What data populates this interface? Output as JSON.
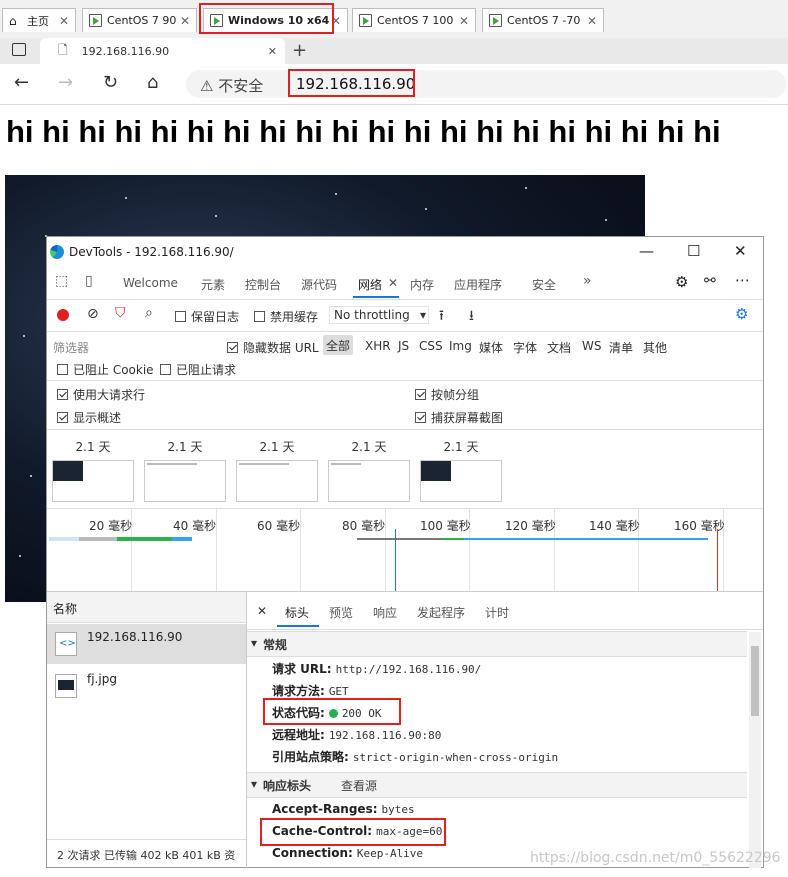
{
  "vm_tabs": [
    {
      "label": "主页"
    },
    {
      "label": "CentOS 7 90"
    },
    {
      "label": "Windows 10 x64",
      "active": true
    },
    {
      "label": "CentOS 7 100"
    },
    {
      "label": "CentOS 7 -70"
    }
  ],
  "browser": {
    "tab_title": "192.168.116.90",
    "insecure_label": "不安全",
    "url": "192.168.116.90"
  },
  "page": {
    "hi_text": "hi hi hi hi hi hi hi hi hi hi hi hi hi hi hi hi hi hi hi hi"
  },
  "devtools": {
    "title": "DevTools - 192.168.116.90/",
    "tabs": [
      "Welcome",
      "元素",
      "控制台",
      "源代码",
      "网络",
      "内存",
      "应用程序",
      "安全"
    ],
    "selected_tab": "网络",
    "toolbar": {
      "preserve_log": "保留日志",
      "disable_cache": "禁用缓存",
      "throttling": "No throttling"
    },
    "filter": {
      "placeholder": "筛选器",
      "hide_data_url": "隐藏数据 URL",
      "all": "全部",
      "types": [
        "XHR",
        "JS",
        "CSS",
        "Img",
        "媒体",
        "字体",
        "文档",
        "WS",
        "清单",
        "其他"
      ],
      "blocked_cookies": "已阻止 Cookie",
      "blocked_requests": "已阻止请求"
    },
    "options": {
      "large_rows": "使用大请求行",
      "group_by_frame": "按帧分组",
      "show_overview": "显示概述",
      "capture_screenshots": "捕获屏幕截图"
    },
    "screenshots": [
      "2.1 天",
      "2.1 天",
      "2.1 天",
      "2.1 天",
      "2.1 天"
    ],
    "timeline_ticks": [
      "20 毫秒",
      "40 毫秒",
      "60 毫秒",
      "80 毫秒",
      "100 毫秒",
      "120 毫秒",
      "140 毫秒",
      "160 毫秒"
    ],
    "list": {
      "header": "名称",
      "items": [
        "192.168.116.90",
        "fj.jpg"
      ],
      "footer": "2 次请求  已传输 402 kB  401 kB 资"
    },
    "detail": {
      "tabs": [
        "标头",
        "预览",
        "响应",
        "发起程序",
        "计时"
      ],
      "general_title": "常规",
      "general": [
        {
          "k": "请求 URL:",
          "v": "http://192.168.116.90/"
        },
        {
          "k": "请求方法:",
          "v": "GET"
        },
        {
          "k": "状态代码:",
          "v": "200 OK"
        },
        {
          "k": "远程地址:",
          "v": "192.168.116.90:80"
        },
        {
          "k": "引用站点策略:",
          "v": "strict-origin-when-cross-origin"
        }
      ],
      "response_title": "响应标头",
      "view_source": "查看源",
      "response": [
        {
          "k": "Accept-Ranges:",
          "v": "bytes"
        },
        {
          "k": "Cache-Control:",
          "v": "max-age=60"
        },
        {
          "k": "Connection:",
          "v": "Keep-Alive"
        }
      ]
    }
  },
  "watermark": "https://blog.csdn.net/m0_55622296",
  "colors": {
    "accent": "#1a73e8",
    "highlight": "#e02020",
    "status_ok": "#22b14c"
  }
}
